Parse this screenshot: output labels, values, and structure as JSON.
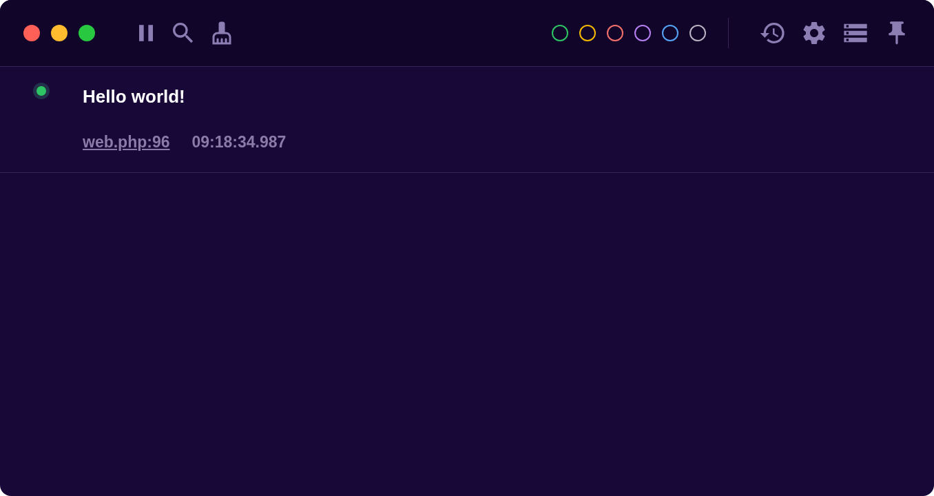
{
  "filters": [
    {
      "color": "#2fc463",
      "selected": false
    },
    {
      "color": "#f5b800",
      "selected": false
    },
    {
      "color": "#f4706b",
      "selected": false
    },
    {
      "color": "#b47ff0",
      "selected": false
    },
    {
      "color": "#55a4f5",
      "selected": false
    },
    {
      "color": "#b9b3c2",
      "selected": false
    }
  ],
  "entries": [
    {
      "color": "#2fc463",
      "message": "Hello world!",
      "origin": "web.php:96",
      "time": "09:18:34.987"
    }
  ]
}
